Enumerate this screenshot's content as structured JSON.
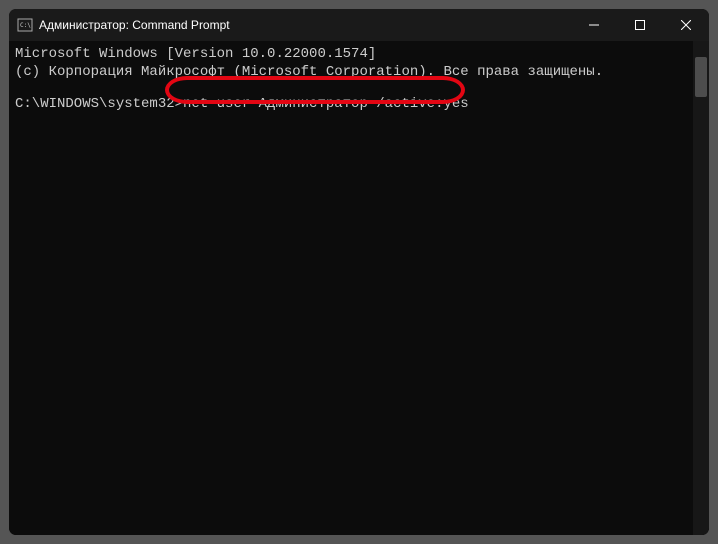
{
  "titlebar": {
    "title": "Администратор: Command Prompt"
  },
  "terminal": {
    "line1": "Microsoft Windows [Version 10.0.22000.1574]",
    "line2": "(c) Корпорация Майкрософт (Microsoft Corporation). Все права защищены.",
    "blank": "",
    "prompt": "C:\\WINDOWS\\system32>",
    "command": "net user Администратор /active:yes"
  }
}
